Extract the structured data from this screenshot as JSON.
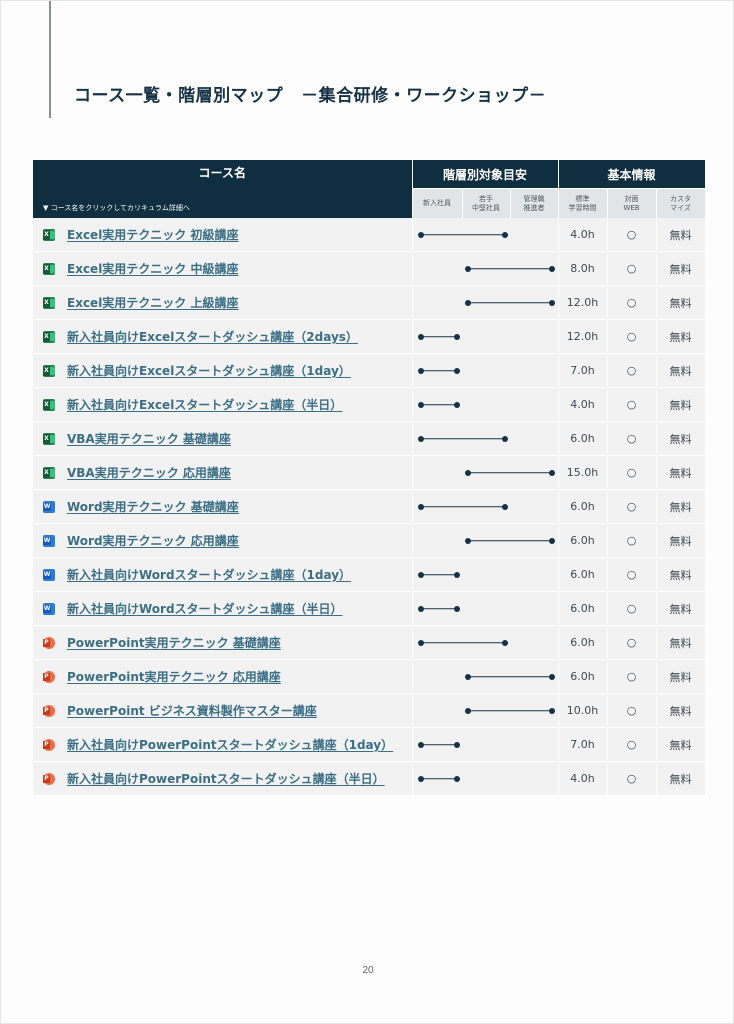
{
  "page": {
    "title": "コース一覧・階層別マップ",
    "subtitle": "－集合研修・ワークショップ－",
    "page_number": "20"
  },
  "table": {
    "header": {
      "course_name": "コース名",
      "hint": "▼ コース名をクリックしてカリキュラム詳細へ",
      "level_group": "階層別対象目安",
      "info_group": "基本情報",
      "level_columns": [
        "新入社員",
        "若手\n中堅社員",
        "管理職\n推進者"
      ],
      "info_columns": [
        "標準\n学習時間",
        "対面\nWEB",
        "カスタ\nマイズ"
      ]
    },
    "rows": [
      {
        "icon": "excel-icon",
        "name": "Excel実用テクニック 初級講座",
        "levels": [
          1,
          2
        ],
        "hours": "4.0h",
        "web": "○",
        "custom": "無料"
      },
      {
        "icon": "excel-icon",
        "name": "Excel実用テクニック 中級講座",
        "levels": [
          2,
          3
        ],
        "hours": "8.0h",
        "web": "○",
        "custom": "無料"
      },
      {
        "icon": "excel-icon",
        "name": "Excel実用テクニック 上級講座",
        "levels": [
          2,
          3
        ],
        "hours": "12.0h",
        "web": "○",
        "custom": "無料"
      },
      {
        "icon": "excel-icon",
        "name": "新入社員向けExcelスタートダッシュ講座（2days）",
        "levels": [
          1,
          1
        ],
        "hours": "12.0h",
        "web": "○",
        "custom": "無料"
      },
      {
        "icon": "excel-icon",
        "name": "新入社員向けExcelスタートダッシュ講座（1day）",
        "levels": [
          1,
          1
        ],
        "hours": "7.0h",
        "web": "○",
        "custom": "無料"
      },
      {
        "icon": "excel-icon",
        "name": "新入社員向けExcelスタートダッシュ講座（半日）",
        "levels": [
          1,
          1
        ],
        "hours": "4.0h",
        "web": "○",
        "custom": "無料"
      },
      {
        "icon": "excel-icon",
        "name": "VBA実用テクニック 基礎講座",
        "levels": [
          1,
          2
        ],
        "hours": "6.0h",
        "web": "○",
        "custom": "無料"
      },
      {
        "icon": "excel-icon",
        "name": "VBA実用テクニック 応用講座",
        "levels": [
          2,
          3
        ],
        "hours": "15.0h",
        "web": "○",
        "custom": "無料"
      },
      {
        "icon": "word-icon",
        "name": "Word実用テクニック 基礎講座",
        "levels": [
          1,
          2
        ],
        "hours": "6.0h",
        "web": "○",
        "custom": "無料"
      },
      {
        "icon": "word-icon",
        "name": "Word実用テクニック 応用講座",
        "levels": [
          2,
          3
        ],
        "hours": "6.0h",
        "web": "○",
        "custom": "無料"
      },
      {
        "icon": "word-icon",
        "name": "新入社員向けWordスタートダッシュ講座（1day）",
        "levels": [
          1,
          1
        ],
        "hours": "6.0h",
        "web": "○",
        "custom": "無料"
      },
      {
        "icon": "word-icon",
        "name": "新入社員向けWordスタートダッシュ講座（半日）",
        "levels": [
          1,
          1
        ],
        "hours": "6.0h",
        "web": "○",
        "custom": "無料"
      },
      {
        "icon": "powerpoint-icon",
        "name": "PowerPoint実用テクニック 基礎講座",
        "levels": [
          1,
          2
        ],
        "hours": "6.0h",
        "web": "○",
        "custom": "無料"
      },
      {
        "icon": "powerpoint-icon",
        "name": "PowerPoint実用テクニック 応用講座",
        "levels": [
          2,
          3
        ],
        "hours": "6.0h",
        "web": "○",
        "custom": "無料"
      },
      {
        "icon": "powerpoint-icon",
        "name": "PowerPoint ビジネス資料製作マスター講座",
        "levels": [
          2,
          3
        ],
        "hours": "10.0h",
        "web": "○",
        "custom": "無料"
      },
      {
        "icon": "powerpoint-icon",
        "name": "新入社員向けPowerPointスタートダッシュ講座（1day）",
        "levels": [
          1,
          1
        ],
        "hours": "7.0h",
        "web": "○",
        "custom": "無料"
      },
      {
        "icon": "powerpoint-icon",
        "name": "新入社員向けPowerPointスタートダッシュ講座（半日）",
        "levels": [
          1,
          1
        ],
        "hours": "4.0h",
        "web": "○",
        "custom": "無料"
      }
    ]
  },
  "colors": {
    "header_dark": "#0f2e40",
    "link": "#3b6f86",
    "bar": "#153246"
  }
}
